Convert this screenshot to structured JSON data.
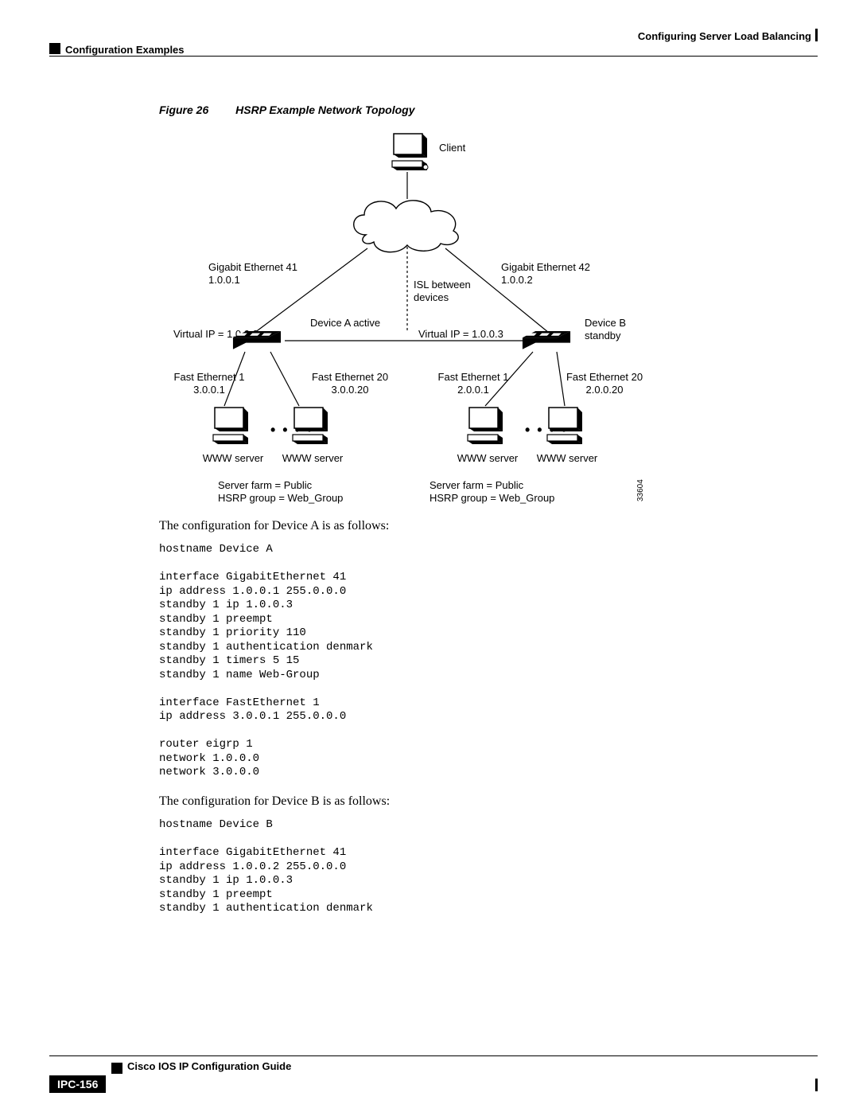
{
  "header": {
    "chapter": "Configuring Server Load Balancing",
    "section": "Configuration Examples"
  },
  "figure": {
    "num": "Figure 26",
    "title": "HSRP Example Network Topology",
    "diagram_id": "33604"
  },
  "labels": {
    "client": "Client",
    "ge41": "Gigabit Ethernet 41",
    "ge41_ip": "1.0.0.1",
    "ge42": "Gigabit Ethernet 42",
    "ge42_ip": "1.0.0.2",
    "isl": "ISL between",
    "isl2": "devices",
    "devA_active": "Device A active",
    "devB_standby": "Device B standby",
    "vipA": "Virtual IP = 1.0.0.3",
    "vipB": "Virtual IP = 1.0.0.3",
    "feA1": "Fast Ethernet 1",
    "feA1_ip": "3.0.0.1",
    "feA20": "Fast Ethernet 20",
    "feA20_ip": "3.0.0.20",
    "feB1": "Fast Ethernet 1",
    "feB1_ip": "2.0.0.1",
    "feB20": "Fast Ethernet 20",
    "feB20_ip": "2.0.0.20",
    "www": "WWW server",
    "farmA1": "Server farm = Public",
    "farmA2": "HSRP group = Web_Group",
    "farmB1": "Server farm = Public",
    "farmB2": "HSRP group = Web_Group"
  },
  "para": {
    "devA": "The configuration for Device A is as follows:",
    "devB": "The configuration for Device B is as follows:"
  },
  "code": {
    "devA": "hostname Device A\n\ninterface GigabitEthernet 41\nip address 1.0.0.1 255.0.0.0\nstandby 1 ip 1.0.0.3\nstandby 1 preempt\nstandby 1 priority 110\nstandby 1 authentication denmark\nstandby 1 timers 5 15\nstandby 1 name Web-Group\n\ninterface FastEthernet 1\nip address 3.0.0.1 255.0.0.0\n\nrouter eigrp 1\nnetwork 1.0.0.0\nnetwork 3.0.0.0",
    "devB": "hostname Device B\n\ninterface GigabitEthernet 41\nip address 1.0.0.2 255.0.0.0\nstandby 1 ip 1.0.0.3\nstandby 1 preempt\nstandby 1 authentication denmark"
  },
  "footer": {
    "book": "Cisco IOS IP Configuration Guide",
    "page": "IPC-156"
  }
}
